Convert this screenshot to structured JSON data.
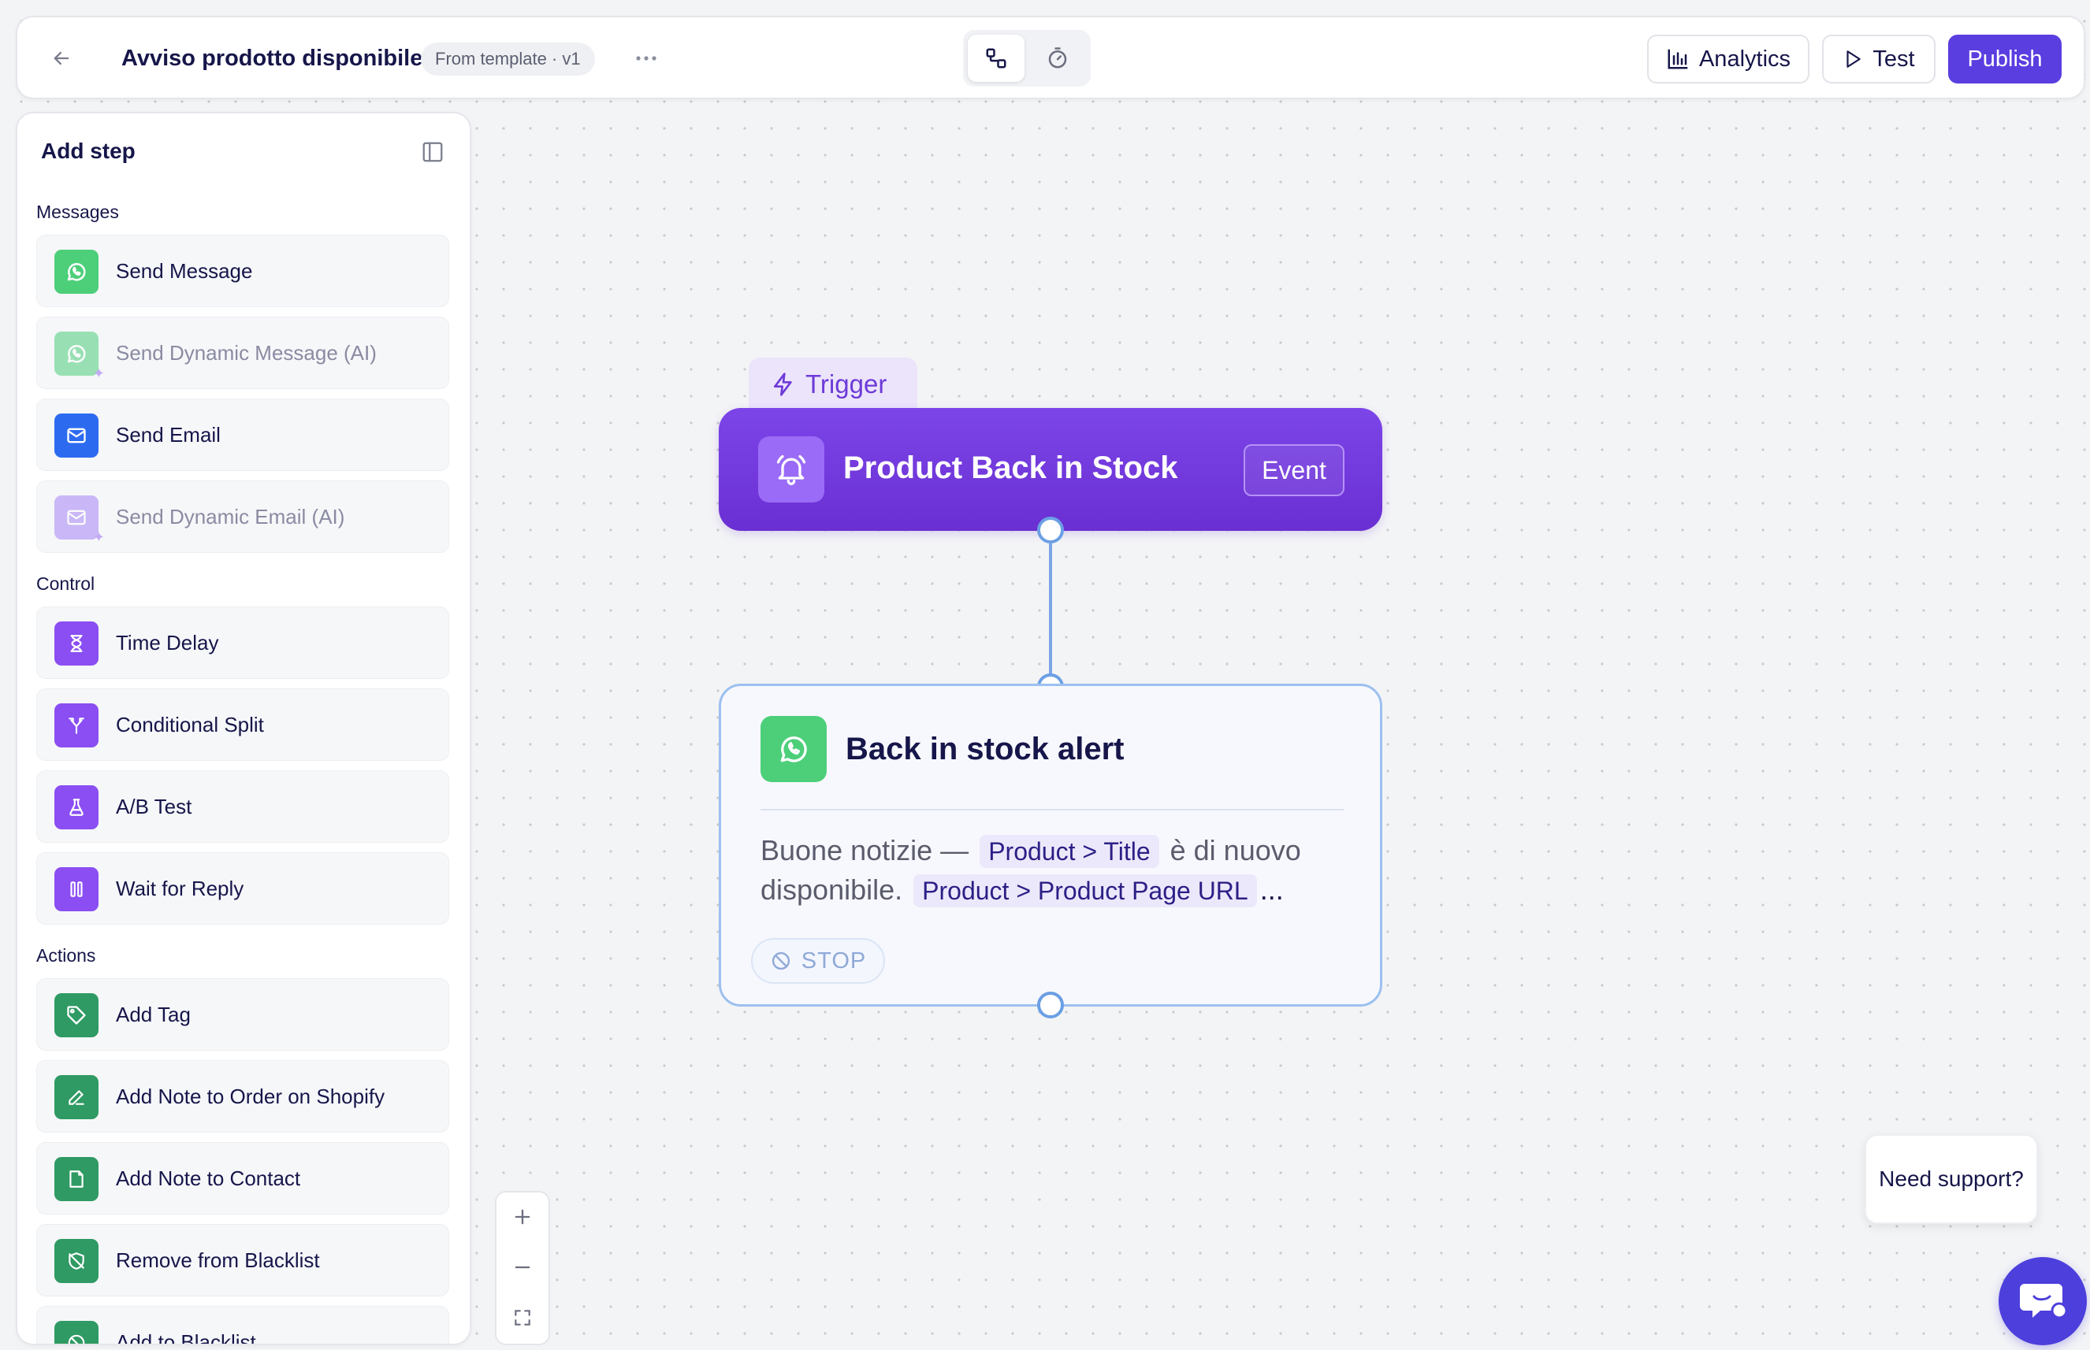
{
  "header": {
    "title": "Avviso prodotto disponibile",
    "template_badge": "From template · v1",
    "analytics_label": "Analytics",
    "test_label": "Test",
    "publish_label": "Publish"
  },
  "sidebar": {
    "title": "Add step",
    "sections": {
      "messages": "Messages",
      "control": "Control",
      "actions": "Actions"
    },
    "items": [
      {
        "label": "Send Message",
        "icon": "whatsapp-icon",
        "color": "#4dcf7a"
      },
      {
        "label": "Send Dynamic Message (AI)",
        "icon": "whatsapp-icon",
        "color": "#4dcf7a"
      },
      {
        "label": "Send Email",
        "icon": "mail-icon",
        "color": "#2c6bf0"
      },
      {
        "label": "Send Dynamic Email (AI)",
        "icon": "mail-icon",
        "color": "#a583f6"
      },
      {
        "label": "Time Delay",
        "icon": "hourglass-icon",
        "color": "#8a4ef2"
      },
      {
        "label": "Conditional Split",
        "icon": "split-icon",
        "color": "#8a4ef2"
      },
      {
        "label": "A/B Test",
        "icon": "flask-icon",
        "color": "#8a4ef2"
      },
      {
        "label": "Wait for Reply",
        "icon": "pause-icon",
        "color": "#8a4ef2"
      },
      {
        "label": "Add Tag",
        "icon": "tag-icon",
        "color": "#2f9a63"
      },
      {
        "label": "Add Note to Order on Shopify",
        "icon": "pencil-icon",
        "color": "#2f9a63"
      },
      {
        "label": "Add Note to Contact",
        "icon": "note-icon",
        "color": "#2f9a63"
      },
      {
        "label": "Remove from Blacklist",
        "icon": "shield-off-icon",
        "color": "#2f9a63"
      },
      {
        "label": "Add to Blacklist",
        "icon": "blocked-icon",
        "color": "#2f9a63"
      }
    ]
  },
  "canvas": {
    "trigger_tab": "Trigger",
    "trigger_node": {
      "title": "Product Back in Stock",
      "badge": "Event",
      "icon": "bell-icon",
      "color": "#7c45e8"
    },
    "message_node": {
      "title": "Back in stock alert",
      "body_part1": "Buone notizie —",
      "var1": "Product > Title",
      "body_part2": "è di nuovo disponibile.",
      "var2": "Product > Product Page URL",
      "ellipsis": "...",
      "stop_label": "STOP"
    }
  },
  "support": {
    "label": "Need support?"
  }
}
